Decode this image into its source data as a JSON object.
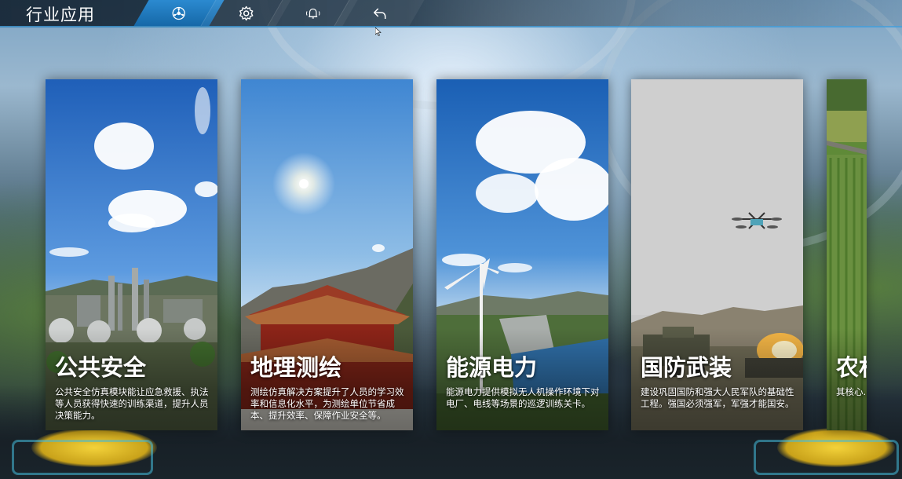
{
  "header": {
    "title": "行业应用",
    "tabs": [
      {
        "icon": "brain-network-icon",
        "active": true
      },
      {
        "icon": "gear-icon",
        "active": false
      },
      {
        "icon": "bell-icon",
        "active": false
      },
      {
        "icon": "back-arrow-icon",
        "active": false
      }
    ]
  },
  "cards": [
    {
      "title": "公共安全",
      "desc": "公共安全仿真模块能让应急救援、执法等人员获得快速的训练渠道，提升人员决策能力。"
    },
    {
      "title": "地理测绘",
      "desc": "测绘仿真解决方案提升了人员的学习效率和信息化水平，为测绘单位节省成本、提升效率、保障作业安全等。"
    },
    {
      "title": "能源电力",
      "desc": "能源电力提供模拟无人机操作环境下对电厂、电线等场景的巡逻训练关卡。"
    },
    {
      "title": "国防武装",
      "desc": "建设巩固国防和强大人民军队的基础性工程。强国必须强军，军强才能国安。"
    },
    {
      "title": "农村",
      "desc": "其核心... 和林木... 病虫害..."
    }
  ],
  "colors": {
    "accent": "#2b8ad0",
    "topbar_border": "#46a0dc",
    "text": "#ffffff"
  }
}
